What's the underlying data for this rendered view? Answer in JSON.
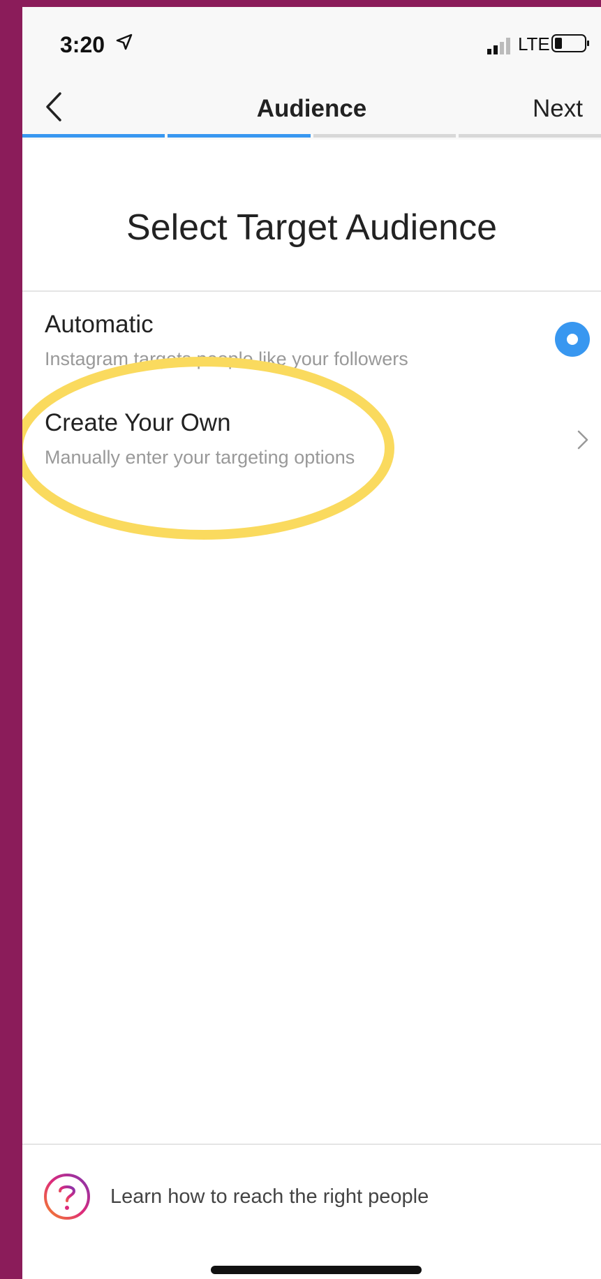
{
  "status": {
    "time": "3:20",
    "network": "LTE"
  },
  "nav": {
    "title": "Audience",
    "next_label": "Next"
  },
  "progress": {
    "total_steps": 4,
    "completed_steps": 2
  },
  "heading": "Select Target Audience",
  "options": [
    {
      "title": "Automatic",
      "subtitle": "Instagram targets people like your followers",
      "selected": true
    },
    {
      "title": "Create Your Own",
      "subtitle": "Manually enter your targeting options",
      "selected": false
    }
  ],
  "footer": {
    "help_text": "Learn how to reach the right people"
  },
  "colors": {
    "accent": "#3897f0",
    "background_frame": "#8b1c5a",
    "highlight": "#fada5e",
    "progress_inactive": "#d8d8d8"
  },
  "icons": {
    "back": "chevron-left-icon",
    "location": "location-arrow-icon",
    "signal": "signal-icon",
    "battery": "battery-icon",
    "chevron": "chevron-right-icon",
    "help": "question-mark-icon"
  }
}
